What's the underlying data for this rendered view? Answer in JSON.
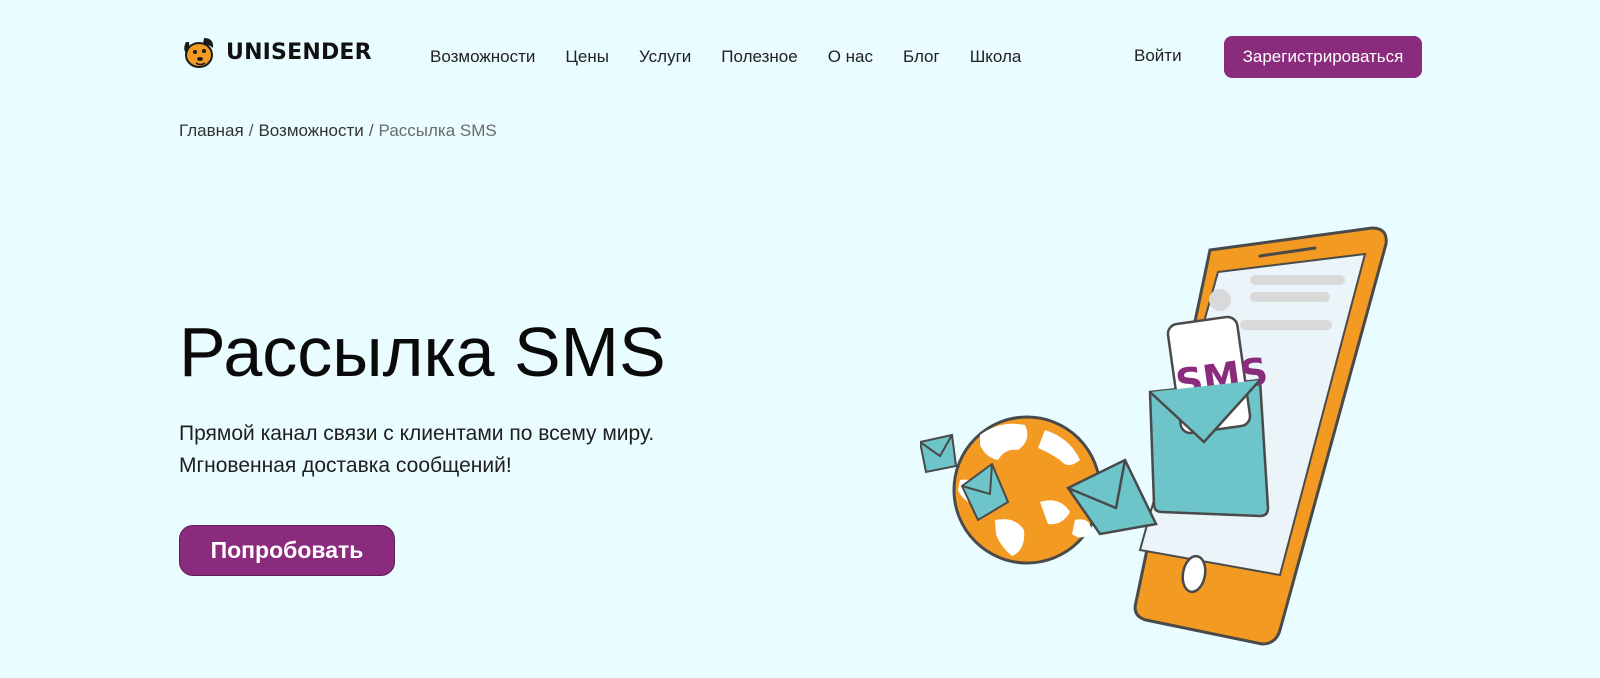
{
  "brand": {
    "name": "UNISENDER",
    "logo_icon": "dog-mascot-icon"
  },
  "nav": {
    "items": [
      {
        "label": "Возможности"
      },
      {
        "label": "Цены"
      },
      {
        "label": "Услуги"
      },
      {
        "label": "Полезное"
      },
      {
        "label": "О нас"
      },
      {
        "label": "Блог"
      },
      {
        "label": "Школа"
      }
    ],
    "login_label": "Войти",
    "signup_label": "Зарегистрироваться"
  },
  "breadcrumb": {
    "items": [
      {
        "label": "Главная"
      },
      {
        "label": "Возможности"
      },
      {
        "label": "Рассылка SMS"
      }
    ],
    "separator": "/"
  },
  "hero": {
    "title": "Рассылка SMS",
    "subtitle_lines": [
      "Прямой канал связи с клиентами по всему миру.",
      "Мгновенная доставка сообщений!"
    ],
    "cta_label": "Попробовать"
  },
  "illustration": {
    "sms_label": "SMS"
  },
  "colors": {
    "background": "#e9fcff",
    "accent": "#8a2b7e",
    "orange": "#f29a22",
    "teal": "#6ec5c9"
  }
}
